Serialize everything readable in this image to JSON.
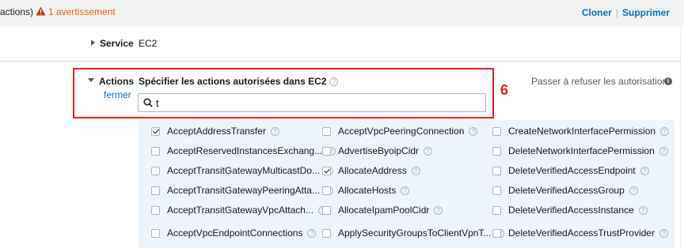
{
  "header": {
    "title_fragment": "actions)",
    "warning_text": "1 avertissement",
    "clone_label": "Cloner",
    "delete_label": "Supprimer",
    "separator": "|"
  },
  "service": {
    "label": "Service",
    "value": "EC2"
  },
  "actions": {
    "label": "Actions",
    "close_label": "fermer",
    "specify_label": "Spécifier les actions autorisées dans EC2",
    "search_value": "t",
    "switch_label": "Passer à refuser les autorisations",
    "annotation_number": "6"
  },
  "action_items": [
    {
      "label": "AcceptAddressTransfer",
      "checked": true
    },
    {
      "label": "AcceptVpcPeeringConnection",
      "checked": false
    },
    {
      "label": "CreateNetworkInterfacePermission",
      "checked": false
    },
    {
      "label": "AcceptReservedInstancesExchang...",
      "checked": false
    },
    {
      "label": "AdvertiseByoipCidr",
      "checked": false
    },
    {
      "label": "DeleteNetworkInterfacePermission",
      "checked": false
    },
    {
      "label": "AcceptTransitGatewayMulticastDo...",
      "checked": false
    },
    {
      "label": "AllocateAddress",
      "checked": true
    },
    {
      "label": "DeleteVerifiedAccessEndpoint",
      "checked": false
    },
    {
      "label": "AcceptTransitGatewayPeeringAtta...",
      "checked": false
    },
    {
      "label": "AllocateHosts",
      "checked": false
    },
    {
      "label": "DeleteVerifiedAccessGroup",
      "checked": false
    },
    {
      "label": "AcceptTransitGatewayVpcAttach...",
      "checked": false
    },
    {
      "label": "AllocateIpamPoolCidr",
      "checked": false
    },
    {
      "label": "DeleteVerifiedAccessInstance",
      "checked": false
    },
    {
      "label": "AcceptVpcEndpointConnections",
      "checked": false
    },
    {
      "label": "ApplySecurityGroupsToClientVpnT...",
      "checked": false
    },
    {
      "label": "DeleteVerifiedAccessTrustProvider",
      "checked": false
    }
  ],
  "colors": {
    "accent_link": "#0073bb",
    "warning": "#d86613",
    "annotation": "#e22026",
    "grid_background": "#eef4fb"
  },
  "icons": {
    "warning": "warning-triangle-icon",
    "search": "search-icon",
    "info": "info-icon",
    "help": "help-circle-icon"
  }
}
